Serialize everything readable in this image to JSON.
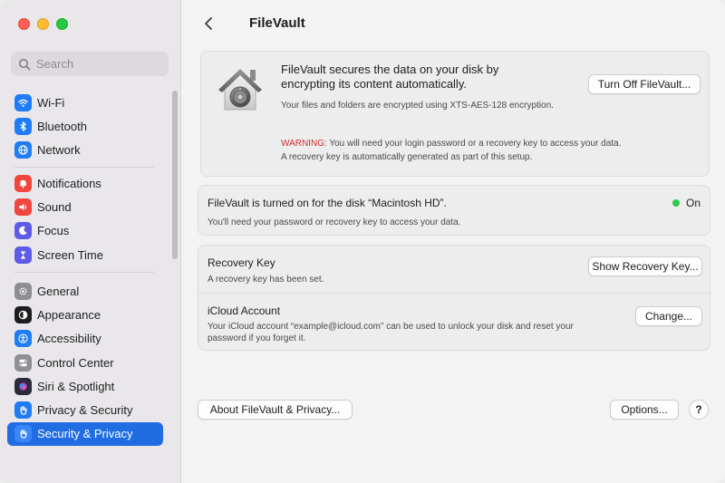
{
  "sidebar": {
    "search_placeholder": "Search",
    "group1": [
      {
        "label": "Wi-Fi",
        "icon": "wifi-icon",
        "color": "#1f7cf6"
      },
      {
        "label": "Bluetooth",
        "icon": "bluetooth-icon",
        "color": "#1f7cf6"
      },
      {
        "label": "Network",
        "icon": "globe-icon",
        "color": "#1f7cf6"
      }
    ],
    "group2": [
      {
        "label": "Notifications",
        "icon": "bell-icon",
        "color": "#f0463e"
      },
      {
        "label": "Sound",
        "icon": "speaker-icon",
        "color": "#f0463e"
      },
      {
        "label": "Focus",
        "icon": "moon-icon",
        "color": "#5e5ce6"
      },
      {
        "label": "Screen Time",
        "icon": "hourglass-icon",
        "color": "#5e5ce6"
      }
    ],
    "group3": [
      {
        "label": "General",
        "icon": "gear-icon",
        "color": "#8e8e93"
      },
      {
        "label": "Appearance",
        "icon": "appearance-icon",
        "color": "#1d1d1f"
      },
      {
        "label": "Accessibility",
        "icon": "accessibility-icon",
        "color": "#1f7cf6"
      },
      {
        "label": "Control Center",
        "icon": "toggles-icon",
        "color": "#8e8e93"
      },
      {
        "label": "Siri & Spotlight",
        "icon": "siri-icon",
        "color": "#2b2b3a"
      },
      {
        "label": "Privacy & Security",
        "icon": "hand-icon",
        "color": "#1f7cf6"
      },
      {
        "label": "Security & Privacy",
        "icon": "hand-icon",
        "color": "#1f7cf6",
        "selected": true
      }
    ]
  },
  "header": {
    "title": "FileVault"
  },
  "hero": {
    "title": "FileVault secures the data on your disk by encrypting its content automatically.",
    "turn_off_label": "Turn Off FileVault...",
    "description": "Your files and folders are encrypted using XTS-AES-128 encryption.",
    "warning_label": "WARNING:",
    "warning_text": " You will need your login password or a recovery key to access your data.",
    "warning_line2": "A recovery key is automatically generated as part of this setup."
  },
  "status": {
    "title": "FileVault is turned on for the disk “Macintosh HD”.",
    "state": "On",
    "description": "You'll need your password or recovery key to access your data."
  },
  "recovery": {
    "title": "Recovery Key",
    "description": "A recovery key has been set.",
    "button_label": "Show Recovery Key..."
  },
  "icloud": {
    "title": "iCloud Account",
    "description": "Your iCloud account “example@icloud.com” can be used to unlock your disk and reset your password if you forget it.",
    "button_label": "Change..."
  },
  "footer": {
    "about_label": "About FileVault & Privacy...",
    "options_label": "Options...",
    "help_label": "?"
  },
  "colors": {
    "accent": "#1f6ce3",
    "status_on": "#30c748",
    "warning": "#d02e2e"
  }
}
